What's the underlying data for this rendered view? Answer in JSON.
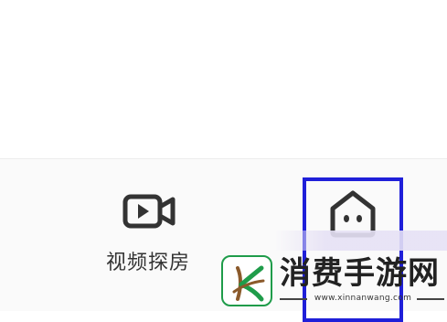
{
  "tabs": {
    "video_tour": {
      "label": "视频探房",
      "icon": "video-camera-icon"
    },
    "home": {
      "label": "",
      "icon": "house-face-icon",
      "highlighted": true
    }
  },
  "watermark": {
    "title": "消费手游网",
    "url": "www.xinnanwang.com",
    "logo_icon": "green-k-leaf-logo"
  },
  "colors": {
    "highlight_border": "#1f1fd9",
    "icon_stroke": "#333333",
    "logo_green": "#1f9c4a",
    "logo_brown": "#8b5a2b"
  }
}
